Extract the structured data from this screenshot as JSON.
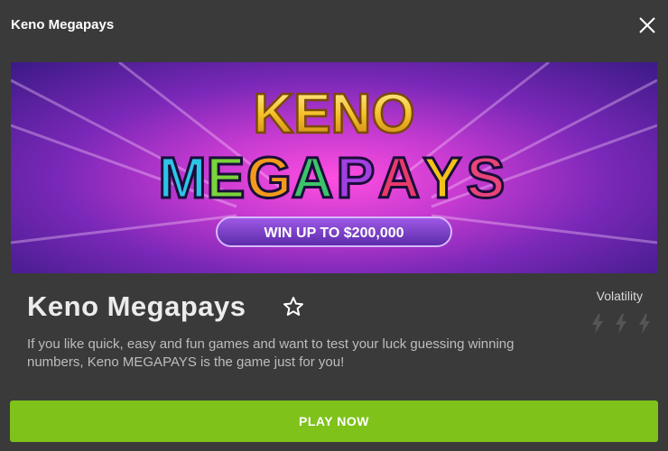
{
  "header": {
    "title": "Keno Megapays"
  },
  "banner": {
    "line1": "KENO",
    "line2_letters": [
      "M",
      "E",
      "G",
      "A",
      "P",
      "A",
      "Y",
      "S"
    ],
    "tagline": "WIN UP TO $200,000"
  },
  "game": {
    "title": "Keno Megapays",
    "description": "If you like quick, easy and fun games and want to test your luck guessing winning numbers, Keno MEGAPAYS is the game just for you!"
  },
  "volatility": {
    "label": "Volatility",
    "icon": "lightning-bolt-icon",
    "level_count": 3
  },
  "play_button": {
    "label": "PLAY NOW"
  },
  "colors": {
    "background": "#3a3a3a",
    "play_button": "#7fc21a",
    "letter_colors": [
      "#2ec4e8",
      "#7ad33a",
      "#f29a1a",
      "#3cc36a",
      "#a23fe0",
      "#e83a6a",
      "#f2c21a",
      "#e8447a"
    ]
  }
}
